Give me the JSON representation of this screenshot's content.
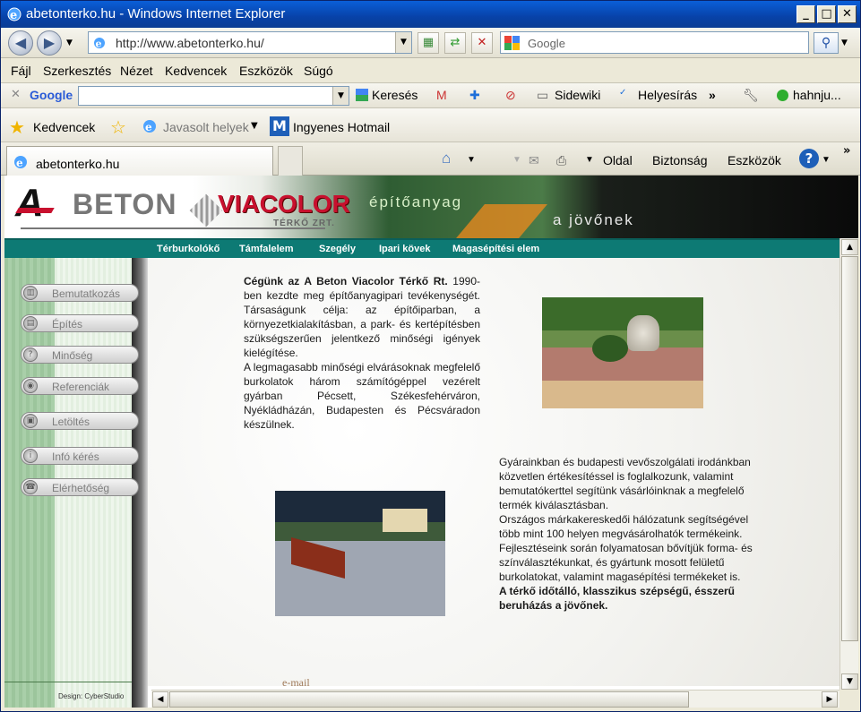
{
  "window": {
    "title": "abetonterko.hu - Windows Internet Explorer",
    "min": "_",
    "max": "□",
    "close": "✕"
  },
  "address": {
    "url": "http://www.abetonterko.hu/",
    "search_placeholder": "Google"
  },
  "menu": {
    "items": [
      "Fájl",
      "Szerkesztés",
      "Nézet",
      "Kedvencek",
      "Eszközök",
      "Súgó"
    ]
  },
  "google_toolbar": {
    "logo": "Google",
    "search": "Keresés",
    "sidewiki": "Sidewiki",
    "spell": "Helyesírás",
    "more": "»",
    "user": "hahnju..."
  },
  "favorites": {
    "label": "Kedvencek",
    "suggested": "Javasolt helyek",
    "hotmail": "Ingyenes Hotmail"
  },
  "tab": {
    "label": "abetonterko.hu"
  },
  "commands": {
    "page": "Oldal",
    "safety": "Biztonság",
    "tools": "Eszközök",
    "more": "»"
  },
  "site": {
    "logo_a": "A",
    "logo_beton": "BETON",
    "logo_viacolor": "VIACOLOR",
    "logo_terko": "TÉRKŐ ZRT.",
    "tagline1": "építőanyag",
    "tagline2": "a jövőnek",
    "nav": [
      "Térburkolókő",
      "Támfalelem",
      "Szegély",
      "Ipari kövek",
      "Magasépítési elem"
    ],
    "left_nav": [
      "Bemutatkozás",
      "Építés",
      "Minőség",
      "Referenciák",
      "Letöltés",
      "Infó kérés",
      "Elérhetőség"
    ],
    "design_credit": "Design: CyberStudio",
    "p1_bold": "Cégünk az A Beton Viacolor Térkő Rt.",
    "p1_text": "1990-ben kezdte meg építőanyagipari tevékenységét. Társaságunk célja: az építőiparban, a környezetkialakításban, a park- és kertépítésben szükségszerűen jelentkező minőségi igények kielégítése.",
    "p1_text2": "A legmagasabb minőségi elvárásoknak megfelelő burkolatok három számítógéppel vezérelt gyárban Pécsett, Székesfehérváron, Nyékládházán, Budapesten és Pécsváradon készülnek.",
    "p2_text": "Gyárainkban és budapesti vevőszolgálati irodánkban közvetlen értékesítéssel is foglalkozunk, valamint bemutatókerttel segítünk vásárlóinknak a megfelelő termék kiválasztásban.",
    "p2_text2": "Országos márkakereskedői hálózatunk segítségével több mint 100 helyen megvásárolhatók termékeink. Fejlesztéseink során folyamatosan bővítjük forma- és színválasztékunkat, és gyártunk mosott felületű burkolatokat, valamint magasépítési termékeket is.",
    "p2_bold": "A térkő időtálló, klasszikus szépségű, ésszerű beruházás a jövőnek.",
    "email": "e-mail"
  }
}
